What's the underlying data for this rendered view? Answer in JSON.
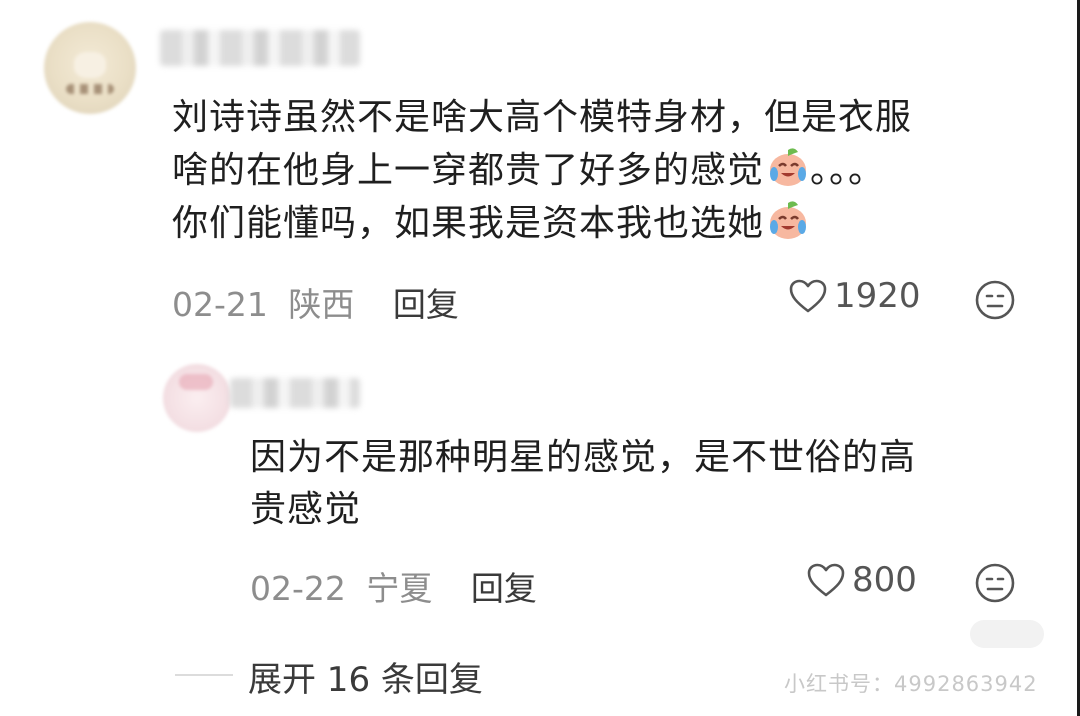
{
  "comment": {
    "text_lines": [
      "刘诗诗虽然不是啥大高个模特身材，但是衣服",
      "啥的在他身上一穿都贵了好多的感觉",
      "你们能懂吗，如果我是资本我也选她"
    ],
    "line2_suffix": "。。。",
    "date": "02-21",
    "location": "陕西",
    "reply_label": "回复",
    "likes": "1920"
  },
  "reply": {
    "text_lines": [
      "因为不是那种明星的感觉，是不世俗的高",
      "贵感觉"
    ],
    "date": "02-22",
    "location": "宁夏",
    "reply_label": "回复",
    "likes": "800"
  },
  "expand_replies": "展开 16 条回复",
  "watermark": "小红书号：4992863942",
  "colors": {
    "text": "#1f1f1f",
    "meta": "#8d8d8d",
    "link": "#3a3a3a",
    "emoji_face": "#f7b8a0",
    "emoji_tear": "#5aa9e6",
    "emoji_leaf": "#6dbb4f"
  },
  "icons": {
    "like": "heart-outline-icon",
    "emoji_button": "face-icon",
    "inline_emoji": "crying-laughing-peach-emoji"
  }
}
